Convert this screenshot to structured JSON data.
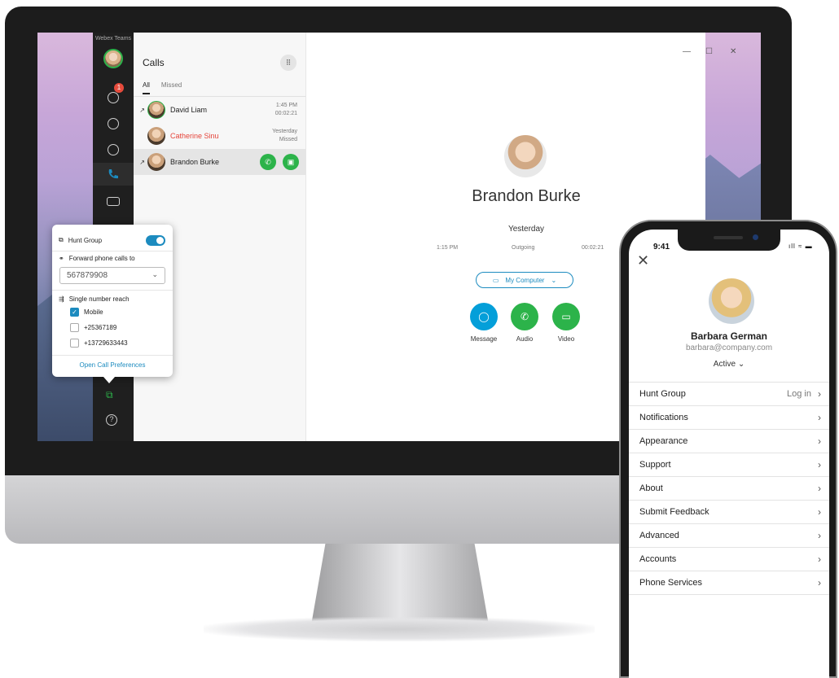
{
  "desktop": {
    "rail": {
      "title": "Webex Teams",
      "badge": "1",
      "icons": [
        "avatar",
        "chat-icon",
        "teams-icon",
        "contacts-icon",
        "phone-icon",
        "voicemail-icon",
        "calendar-icon",
        "call-settings-icon",
        "help-icon"
      ]
    },
    "calls": {
      "title": "Calls",
      "dialpad_icon": "dialpad-icon",
      "tabs": [
        "All",
        "Missed"
      ],
      "rows": [
        {
          "name": "David Liam",
          "time": "1:45 PM",
          "detail": "00:02:21",
          "outgoing": true,
          "missed": false
        },
        {
          "name": "Catherine Sinu",
          "time": "Yesterday",
          "detail": "Missed",
          "outgoing": false,
          "missed": true
        },
        {
          "name": "Brandon Burke",
          "time": "",
          "detail": "",
          "outgoing": true,
          "missed": false
        }
      ]
    },
    "detail": {
      "name": "Brandon Burke",
      "when": "Yesterday",
      "time": "1:15 PM",
      "direction": "Outgoing",
      "duration": "00:02:21",
      "device": "My Computer",
      "actions": [
        {
          "label": "Message",
          "color": "#049fd9"
        },
        {
          "label": "Audio",
          "color": "#2cb34a"
        },
        {
          "label": "Video",
          "color": "#2cb34a"
        }
      ]
    },
    "popover": {
      "hunt_group": "Hunt Group",
      "hunt_group_on": true,
      "forward_label": "Forward phone calls to",
      "forward_value": "567879908",
      "snr_label": "Single number reach",
      "options": [
        {
          "label": "Mobile",
          "checked": true
        },
        {
          "label": "+25367189",
          "checked": false
        },
        {
          "label": "+13729633443",
          "checked": false
        }
      ],
      "link": "Open Call Preferences"
    }
  },
  "phone": {
    "status_time": "9:41",
    "user_name": "Barbara German",
    "user_email": "barbara@company.com",
    "status": "Active",
    "menu": [
      {
        "label": "Hunt Group",
        "value": "Log in"
      },
      {
        "label": "Notifications",
        "value": ""
      },
      {
        "label": "Appearance",
        "value": ""
      },
      {
        "label": "Support",
        "value": ""
      },
      {
        "label": "About",
        "value": ""
      },
      {
        "label": "Submit Feedback",
        "value": ""
      },
      {
        "label": "Advanced",
        "value": ""
      },
      {
        "label": "Accounts",
        "value": ""
      },
      {
        "label": "Phone Services",
        "value": ""
      }
    ]
  },
  "colors": {
    "accent": "#1c8bbf",
    "green": "#2cb34a",
    "missed": "#e5453b",
    "rail": "#1f1f1f"
  }
}
